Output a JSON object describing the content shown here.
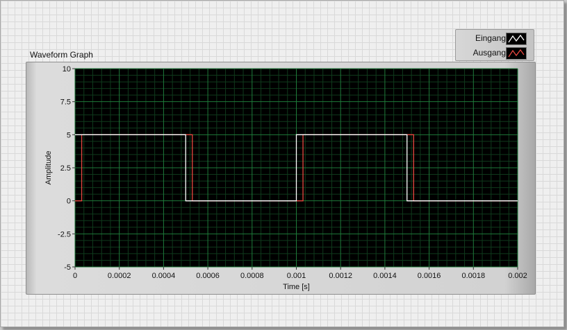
{
  "window": {
    "graph_label": "Waveform Graph"
  },
  "legend": {
    "items": [
      {
        "name": "Eingang",
        "color": "#ffffff"
      },
      {
        "name": "Ausgang",
        "color": "#e8473f"
      }
    ]
  },
  "colors": {
    "plot_background": "#000000",
    "major_grid": "#1e7a3a",
    "minor_grid": "#0f3a1c"
  },
  "chart_data": {
    "type": "line",
    "title": "Waveform Graph",
    "xlabel": "Time [s]",
    "ylabel": "Amplitude",
    "xlim": [
      0,
      0.002
    ],
    "ylim": [
      -5,
      10
    ],
    "grid": true,
    "legend_position": "top-right",
    "x_ticks": [
      0,
      0.0002,
      0.0004,
      0.0006,
      0.0008,
      0.001,
      0.0012,
      0.0014,
      0.0016,
      0.0018,
      0.002
    ],
    "x_tick_labels": [
      "0",
      "0.0002",
      "0.0004",
      "0.0006",
      "0.0008",
      "0.001",
      "0.0012",
      "0.0014",
      "0.0016",
      "0.0018",
      "0.002"
    ],
    "y_ticks": [
      -5,
      -2.5,
      0,
      2.5,
      5,
      7.5,
      10
    ],
    "y_tick_labels": [
      "-5",
      "-2.5",
      "0",
      "2.5",
      "5",
      "7.5",
      "10"
    ],
    "series": [
      {
        "name": "Eingang",
        "step": true,
        "x": [
          0,
          0.0005,
          0.0005,
          0.001,
          0.001,
          0.0015,
          0.0015,
          0.002
        ],
        "y": [
          5,
          5,
          0,
          0,
          5,
          5,
          0,
          0
        ]
      },
      {
        "name": "Ausgang",
        "step": true,
        "x": [
          0,
          3e-05,
          3e-05,
          0.00053,
          0.00053,
          0.00103,
          0.00103,
          0.00153,
          0.00153,
          0.002
        ],
        "y": [
          0,
          0,
          5,
          5,
          0,
          0,
          5,
          5,
          0,
          0
        ]
      }
    ]
  }
}
